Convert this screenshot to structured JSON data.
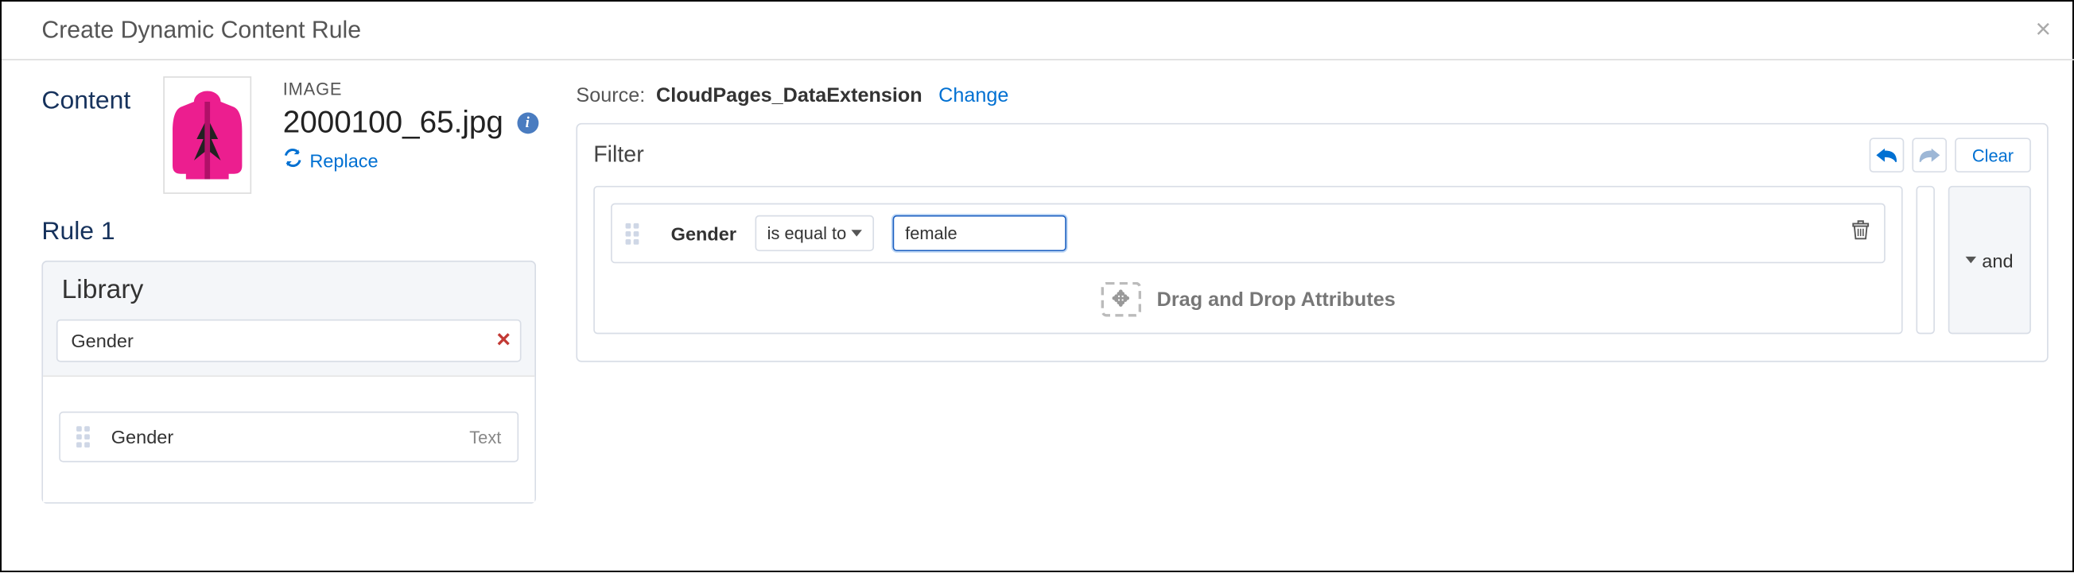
{
  "modal": {
    "title": "Create Dynamic Content Rule"
  },
  "content": {
    "label": "Content",
    "type": "IMAGE",
    "filename": "2000100_65.jpg",
    "replace_label": "Replace"
  },
  "rule": {
    "title": "Rule 1"
  },
  "library": {
    "title": "Library",
    "search_value": "Gender",
    "items": [
      {
        "name": "Gender",
        "type": "Text"
      }
    ]
  },
  "source": {
    "label": "Source:",
    "name": "CloudPages_DataExtension",
    "change_label": "Change"
  },
  "filter": {
    "title": "Filter",
    "clear_label": "Clear",
    "condition": {
      "attribute": "Gender",
      "operator": "is equal to",
      "value": "female"
    },
    "drop_label": "Drag and Drop Attributes",
    "and_label": "and"
  }
}
